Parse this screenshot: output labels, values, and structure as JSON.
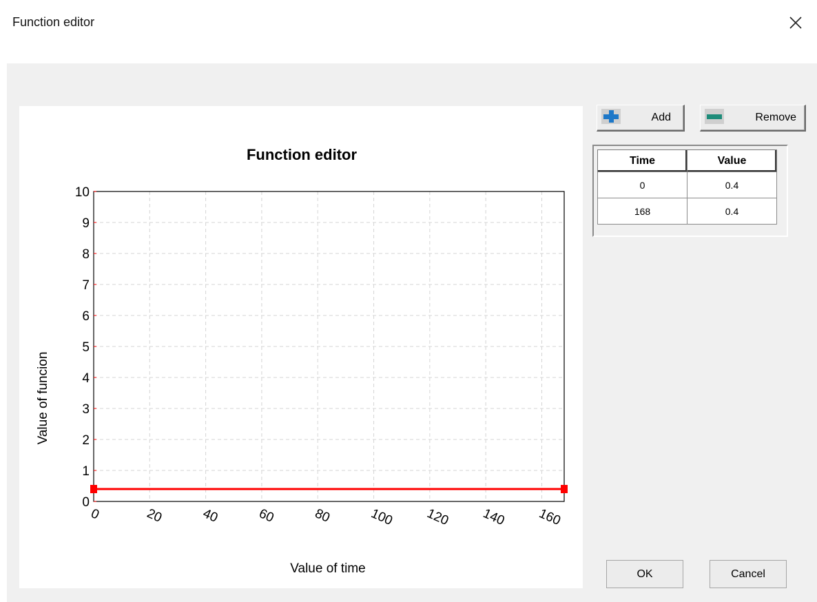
{
  "window": {
    "title": "Function editor"
  },
  "toolbar": {
    "add_label": "Add",
    "remove_label": "Remove"
  },
  "table": {
    "columns": [
      "Time",
      "Value"
    ],
    "rows": [
      {
        "time": "0",
        "value": "0.4"
      },
      {
        "time": "168",
        "value": "0.4"
      }
    ]
  },
  "footer": {
    "ok_label": "OK",
    "cancel_label": "Cancel"
  },
  "colors": {
    "series": "#ff0000",
    "add_icon": "#1e78c8",
    "remove_icon": "#1e8c7a"
  },
  "chart_data": {
    "type": "line",
    "title": "Function editor",
    "xlabel": "Value of time",
    "ylabel": "Value of funcion",
    "xlim": [
      0,
      168
    ],
    "ylim": [
      0,
      10
    ],
    "xticks": [
      0,
      20,
      40,
      60,
      80,
      100,
      120,
      140,
      160
    ],
    "yticks": [
      0,
      1,
      2,
      3,
      4,
      5,
      6,
      7,
      8,
      9,
      10
    ],
    "grid": true,
    "series": [
      {
        "x": [
          0,
          168
        ],
        "y": [
          0.4,
          0.4
        ]
      }
    ]
  }
}
